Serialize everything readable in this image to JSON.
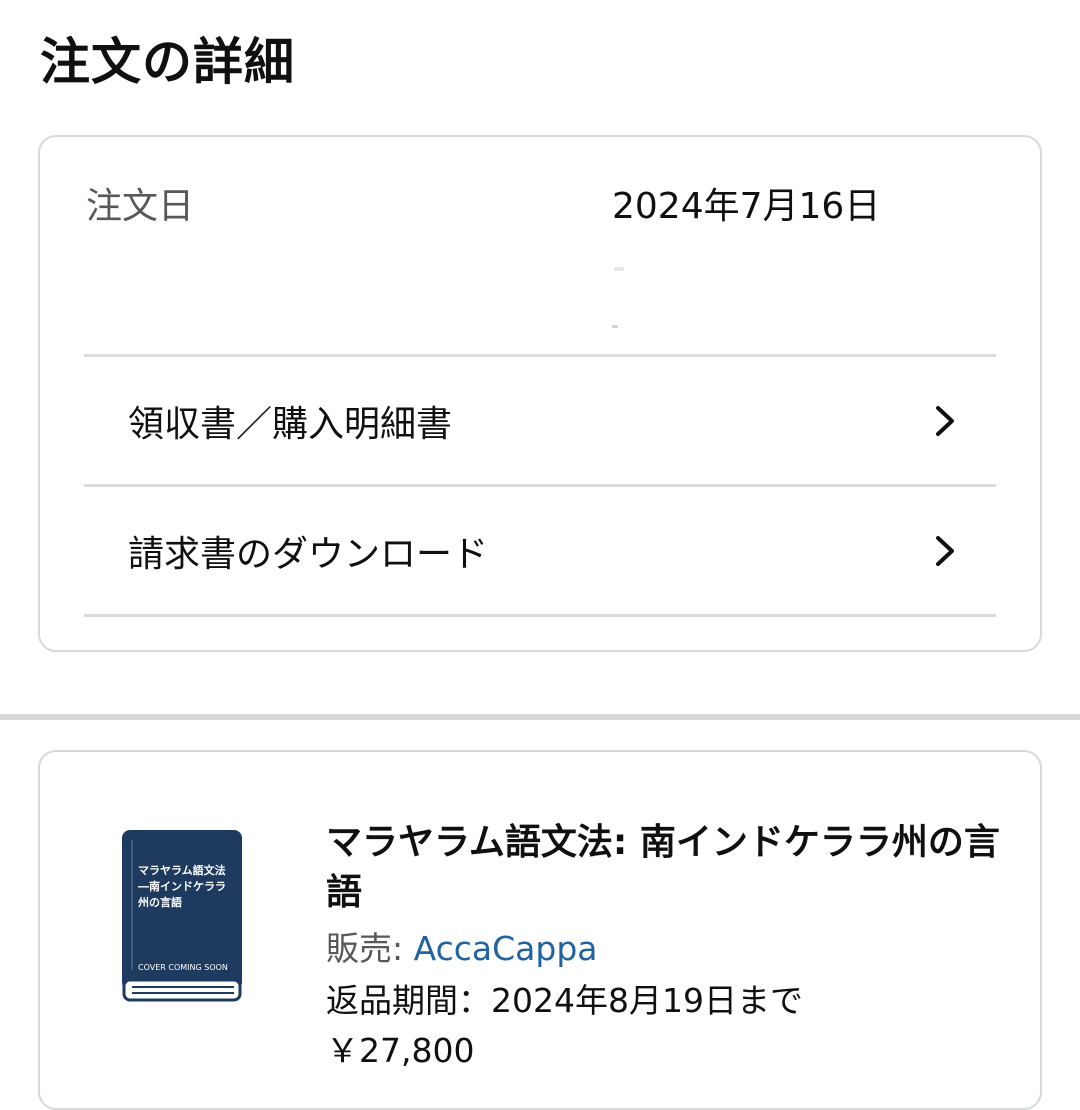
{
  "page": {
    "title": "注文の詳細"
  },
  "order": {
    "date_label": "注文日",
    "date_value": "2024年7月16日"
  },
  "links": [
    {
      "label": "領収書／購入明細書",
      "icon": "chevron-right-icon"
    },
    {
      "label": "請求書のダウンロード",
      "icon": "chevron-right-icon"
    }
  ],
  "item": {
    "title": "マラヤラム語文法: 南インドケララ州の言語",
    "seller_label": "販売: ",
    "seller_name": "AccaCappa",
    "return_window": "返品期間：2024年8月19日まで",
    "price": "￥27,800",
    "cover": {
      "title_line1": "マラヤラム語文法",
      "title_line2": "―南インドケララ",
      "title_line3": "州の言語",
      "footer": "COVER COMING SOON",
      "color": "#1e3a5f"
    }
  }
}
